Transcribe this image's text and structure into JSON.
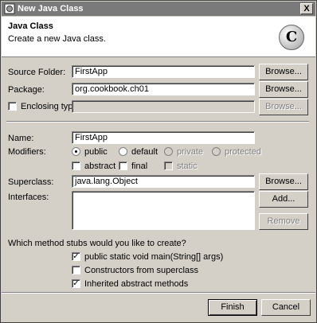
{
  "window": {
    "title": "New Java Class",
    "close_label": "X"
  },
  "header": {
    "title": "Java Class",
    "description": "Create a new Java class.",
    "logo_letter": "C"
  },
  "form": {
    "source_folder": {
      "label": "Source Folder:",
      "value": "FirstApp",
      "browse": "Browse..."
    },
    "package": {
      "label": "Package:",
      "value": "org.cookbook.ch01",
      "browse": "Browse..."
    },
    "enclosing": {
      "label": "Enclosing type:",
      "value": "",
      "browse": "Browse..."
    },
    "name": {
      "label": "Name:",
      "value": "FirstApp"
    },
    "modifiers": {
      "label": "Modifiers:",
      "public": "public",
      "default": "default",
      "private": "private",
      "protected": "protected",
      "abstract": "abstract",
      "final": "final",
      "static": "static"
    },
    "superclass": {
      "label": "Superclass:",
      "value": "java.lang.Object",
      "browse": "Browse..."
    },
    "interfaces": {
      "label": "Interfaces:",
      "add": "Add...",
      "remove": "Remove"
    },
    "stubs": {
      "question": "Which method stubs would you like to create?",
      "main": "public static void main(String[] args)",
      "constructors": "Constructors from superclass",
      "inherited": "Inherited abstract methods"
    }
  },
  "buttons": {
    "finish": "Finish",
    "cancel": "Cancel"
  }
}
